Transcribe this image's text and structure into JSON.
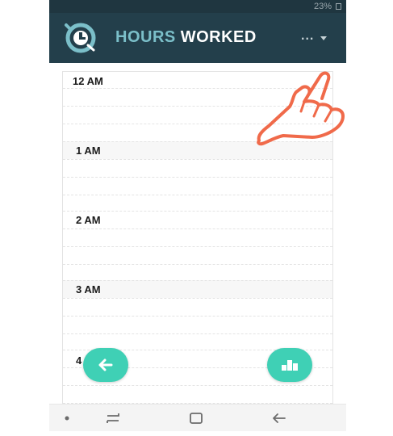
{
  "status_bar": {
    "battery": "23%"
  },
  "app_bar": {
    "title_part1": "HOURS",
    "title_part2": "WORKED",
    "menu_dots": "...",
    "logo_icon": "clock-timer-icon"
  },
  "calendar": {
    "hours": [
      "12 AM",
      "1 AM",
      "2 AM",
      "3 AM",
      "4"
    ]
  },
  "fabs": {
    "back_icon": "arrow-left-icon",
    "stats_icon": "bar-chart-icon",
    "color": "#3fd0b5"
  },
  "nav_bar": {
    "icons": [
      "dot-icon",
      "recents-icon",
      "home-icon",
      "back-icon"
    ]
  },
  "colors": {
    "app_bar": "#233f4b",
    "status_bar": "#1f3640",
    "title_accent": "#7bbfc9",
    "hand_overlay": "#f06a4a"
  }
}
